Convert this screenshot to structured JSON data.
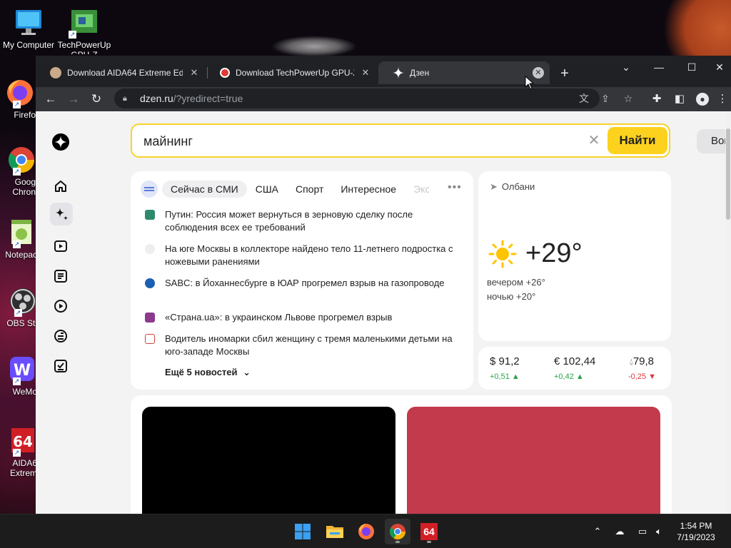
{
  "desktop": {
    "icons": [
      {
        "label": "My Computer"
      },
      {
        "label": "TechPowerUp",
        "label2": "GPU-Z"
      },
      {
        "label": "Firefo"
      },
      {
        "label": "Goog",
        "label2": "Chron"
      },
      {
        "label": "Notepac"
      },
      {
        "label": "OBS Stu"
      },
      {
        "label": "WeMo"
      },
      {
        "label": "AIDA6",
        "label2": "Extrem"
      }
    ]
  },
  "browser": {
    "tabs": [
      {
        "title": "Download AIDA64 Extreme Editi"
      },
      {
        "title": "Download TechPowerUp GPU-Z"
      },
      {
        "title": "Дзен"
      }
    ],
    "new_tab": "+",
    "window_controls": {
      "dropdown": "⌄",
      "minimize": "—",
      "maximize": "☐",
      "close": "✕"
    },
    "address": {
      "host": "dzen.ru",
      "path": "/?yredirect=true"
    }
  },
  "page": {
    "search": {
      "value": "майнинг",
      "clear": "✕",
      "button": "Найти"
    },
    "login_button": "Вой",
    "news": {
      "tabs": [
        "Сейчас в СМИ",
        "США",
        "Спорт",
        "Интересное",
        "Экс"
      ],
      "more_icon": "•••",
      "items": [
        {
          "text": "Путин: Россия может вернуться в зерновую сделку после соблюдения всех ее требований",
          "source_color": "#2e8a6e"
        },
        {
          "text": "На юге Москвы в коллекторе найдено тело 11-летнего подростка с ножевыми ранениями",
          "source_color": "#555555"
        },
        {
          "text": "SABC: в Йоханнесбурге в ЮАР прогремел взрыв на газопроводе",
          "source_color": "#1a5fb4"
        },
        {
          "text": "«Страна.ua»: в украинском Львове прогремел взрыв",
          "source_color": "#8c3a8c"
        },
        {
          "text": "Водитель иномарки сбил женщину с тремя маленькими детьми на юго-западе Москвы",
          "source_color": "#d8413a"
        }
      ],
      "more_news": "Ещё 5 новостей"
    },
    "weather": {
      "city": "Олбани",
      "temp": "+29°",
      "evening": "вечером +26°",
      "night": "ночью +20°"
    },
    "rates": [
      {
        "value": "$ 91,2",
        "delta": "+0,51 ▲",
        "trend": "up"
      },
      {
        "value": "€ 102,44",
        "delta": "+0,42 ▲",
        "trend": "up"
      },
      {
        "value": "79,8",
        "delta": "-0,25 ▼",
        "trend": "down"
      }
    ],
    "feed_colors": [
      "#000000",
      "#c23a4b"
    ]
  },
  "taskbar": {
    "apps": [
      "start-icon",
      "file-explorer-icon",
      "firefox-icon",
      "chrome-icon",
      "aida64-icon"
    ],
    "aida_label": "64",
    "time": "1:54 PM",
    "date": "7/19/2023"
  }
}
